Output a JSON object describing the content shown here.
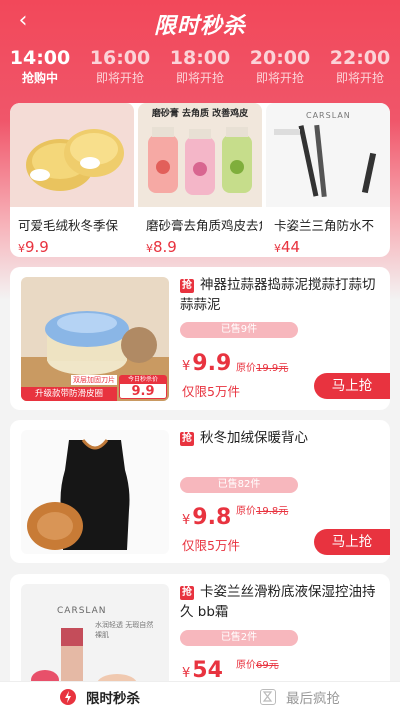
{
  "header": {
    "title": "限时秒杀",
    "back_glyph": "‹"
  },
  "time_slots": [
    {
      "time": "14:00",
      "status": "抢购中",
      "active": true
    },
    {
      "time": "16:00",
      "status": "即将开抢",
      "active": false
    },
    {
      "time": "18:00",
      "status": "即将开抢",
      "active": false
    },
    {
      "time": "20:00",
      "status": "即将开抢",
      "active": false
    },
    {
      "time": "22:00",
      "status": "即将开抢",
      "active": false
    }
  ],
  "top_products": [
    {
      "name": "可爱毛绒秋冬季保",
      "currency": "¥",
      "price": "9.9"
    },
    {
      "name": "磨砂膏去角质鸡皮去角",
      "currency": "¥",
      "price": "8.9",
      "banner": "磨砂膏 去角质 改善鸡皮"
    },
    {
      "name": "卡姿兰三角防水不",
      "currency": "¥",
      "price": "44",
      "brand": "CARSLAN"
    }
  ],
  "products": [
    {
      "tag": "抢",
      "name": "神器拉蒜器捣蒜泥搅蒜打蒜切蒜蒜泥",
      "sold": "已售9件",
      "currency": "¥",
      "price": "9.9",
      "orig_label": "原价",
      "orig_price": "19.9元",
      "limit": "仅限5万件",
      "buy": "马上抢",
      "img_banner": "升级款带防滑皮圈",
      "img_badge": "今日秒杀价",
      "img_price": "9.9",
      "img_note": "双层加固刀片"
    },
    {
      "tag": "抢",
      "name": "秋冬加绒保暖背心",
      "sold": "已售82件",
      "currency": "¥",
      "price": "9.8",
      "orig_label": "原价",
      "orig_price": "19.8元",
      "limit": "仅限5万件",
      "buy": "马上抢"
    },
    {
      "tag": "抢",
      "name": "卡姿兰丝滑粉底液保湿控油持久 bb霜",
      "sold": "已售2件",
      "currency": "¥",
      "price": "54",
      "orig_label": "原价",
      "orig_price": "69元",
      "brand": "CARSLAN",
      "img_note": "水润轻透 无瑕自然裸肌"
    }
  ],
  "tabbar": [
    {
      "label": "限时秒杀",
      "active": true
    },
    {
      "label": "最后疯抢",
      "active": false
    }
  ],
  "colors": {
    "accent": "#e8333f",
    "header": "#f2485a",
    "sold_bar": "#f7b7bd"
  }
}
